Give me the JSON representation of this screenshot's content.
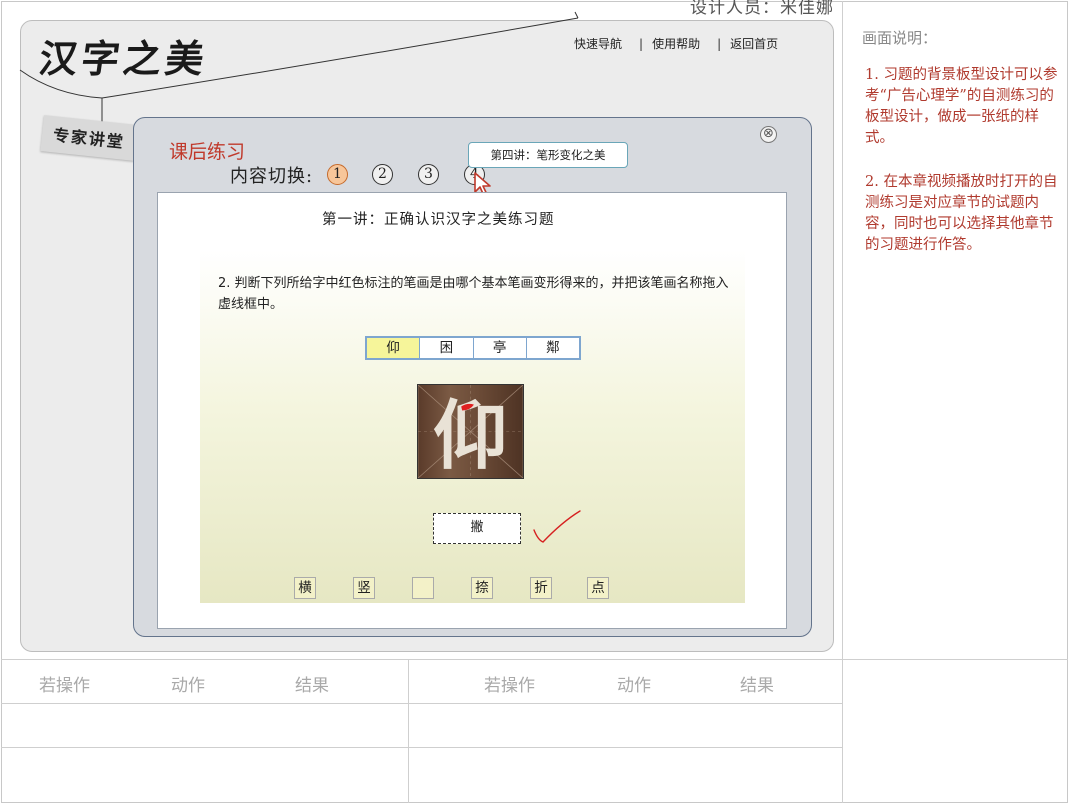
{
  "designer": "设计人员：米佳娜",
  "logo": "汉字之美",
  "topnav": {
    "quick_nav": "快速导航",
    "help": "使用帮助",
    "home": "返回首页",
    "separator": "|"
  },
  "expert_tag": "专家讲堂",
  "panel": {
    "title": "课后练习",
    "close_symbol": "⊗",
    "switch_label": "内容切换:",
    "numbers": [
      "1",
      "2",
      "3",
      "4"
    ],
    "active_number": "1",
    "tooltip": "第四讲：笔形变化之美"
  },
  "paper": {
    "title": "第一讲：正确认识汉字之美练习题",
    "question": "2. 判断下列所给字中红色标注的笔画是由哪个基本笔画变形得来的，并把该笔画名称拖入虚线框中。",
    "char_tabs": [
      "仰",
      "困",
      "亭",
      "鄰"
    ],
    "selected_tab": "仰",
    "image_char": "仰",
    "answer": "撇",
    "options": [
      "横",
      "竖",
      "",
      "捺",
      "折",
      "点"
    ]
  },
  "description": {
    "title": "画面说明：",
    "para1": "1. 习题的背景板型设计可以参考“广告心理学”的自测练习的板型设计，做成一张纸的样式。",
    "para2": "2. 在本章视频播放时打开的自测练习是对应章节的试题内容，同时也可以选择其他章节的习题进行作答。"
  },
  "table": {
    "headers_left": [
      "若操作",
      "动作",
      "结果"
    ],
    "headers_right": [
      "若操作",
      "动作",
      "结果"
    ]
  },
  "colors": {
    "accent_red": "#c0392b",
    "panel_border": "#64748c",
    "tab_border": "#7ea6cf",
    "selected_tab": "#f6f59a",
    "active_number": "#f7c69a"
  }
}
